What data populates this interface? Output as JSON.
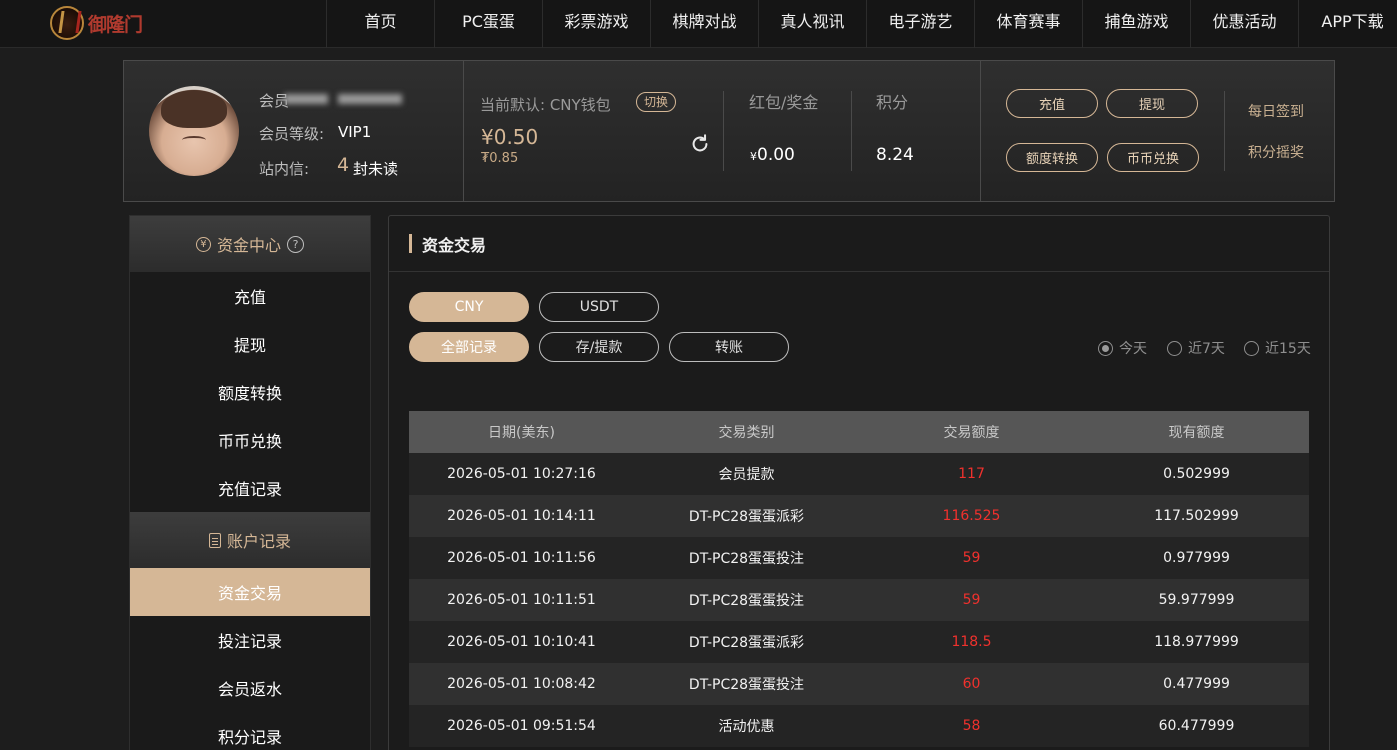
{
  "brand": {
    "name": "御隆门"
  },
  "nav": [
    "首页",
    "PC蛋蛋",
    "彩票游戏",
    "棋牌对战",
    "真人视讯",
    "电子游艺",
    "体育赛事",
    "捕鱼游戏",
    "优惠活动",
    "APP下载"
  ],
  "user": {
    "member_label": "会员",
    "level_label": "会员等级:",
    "level": "VIP1",
    "inbox_label": "站内信:",
    "unread_count": "4",
    "unread_suffix": "封未读"
  },
  "wallet": {
    "default_label": "当前默认: CNY钱包",
    "switch_label": "切换",
    "balance": "¥0.50",
    "balance_sub": "₮0.85"
  },
  "stats": {
    "bonus_label": "红包/奖金",
    "bonus_currency": "¥",
    "bonus_value": "0.00",
    "points_label": "积分",
    "points_value": "8.24"
  },
  "actions": {
    "recharge": "充值",
    "withdraw": "提现",
    "transfer": "额度转换",
    "exchange": "币币兑换",
    "daily_checkin": "每日签到",
    "points_lottery": "积分摇奖"
  },
  "sidebar": {
    "funds_header": "资金中心",
    "funds_items": [
      "充值",
      "提现",
      "额度转换",
      "币币兑换",
      "充值记录"
    ],
    "account_header": "账户记录",
    "account_items": [
      "资金交易",
      "投注记录",
      "会员返水",
      "积分记录"
    ],
    "active_item": "资金交易"
  },
  "main": {
    "title": "资金交易",
    "currency_tabs": [
      "CNY",
      "USDT"
    ],
    "type_tabs": [
      "全部记录",
      "存/提款",
      "转账"
    ],
    "ranges": [
      "今天",
      "近7天",
      "近15天"
    ],
    "selected_range": "今天",
    "table": {
      "headers": [
        "日期(美东)",
        "交易类别",
        "交易额度",
        "现有额度"
      ],
      "rows": [
        [
          "2026-05-01 10:27:16",
          "会员提款",
          "117",
          "0.502999"
        ],
        [
          "2026-05-01 10:14:11",
          "DT-PC28蛋蛋派彩",
          "116.525",
          "117.502999"
        ],
        [
          "2026-05-01 10:11:56",
          "DT-PC28蛋蛋投注",
          "59",
          "0.977999"
        ],
        [
          "2026-05-01 10:11:51",
          "DT-PC28蛋蛋投注",
          "59",
          "59.977999"
        ],
        [
          "2026-05-01 10:10:41",
          "DT-PC28蛋蛋派彩",
          "118.5",
          "118.977999"
        ],
        [
          "2026-05-01 10:08:42",
          "DT-PC28蛋蛋投注",
          "60",
          "0.477999"
        ],
        [
          "2026-05-01 09:51:54",
          "活动优惠",
          "58",
          "60.477999"
        ]
      ]
    }
  },
  "colors": {
    "accent": "#d5b796",
    "amount": "#f0312d",
    "background": "#1d1d1d"
  }
}
